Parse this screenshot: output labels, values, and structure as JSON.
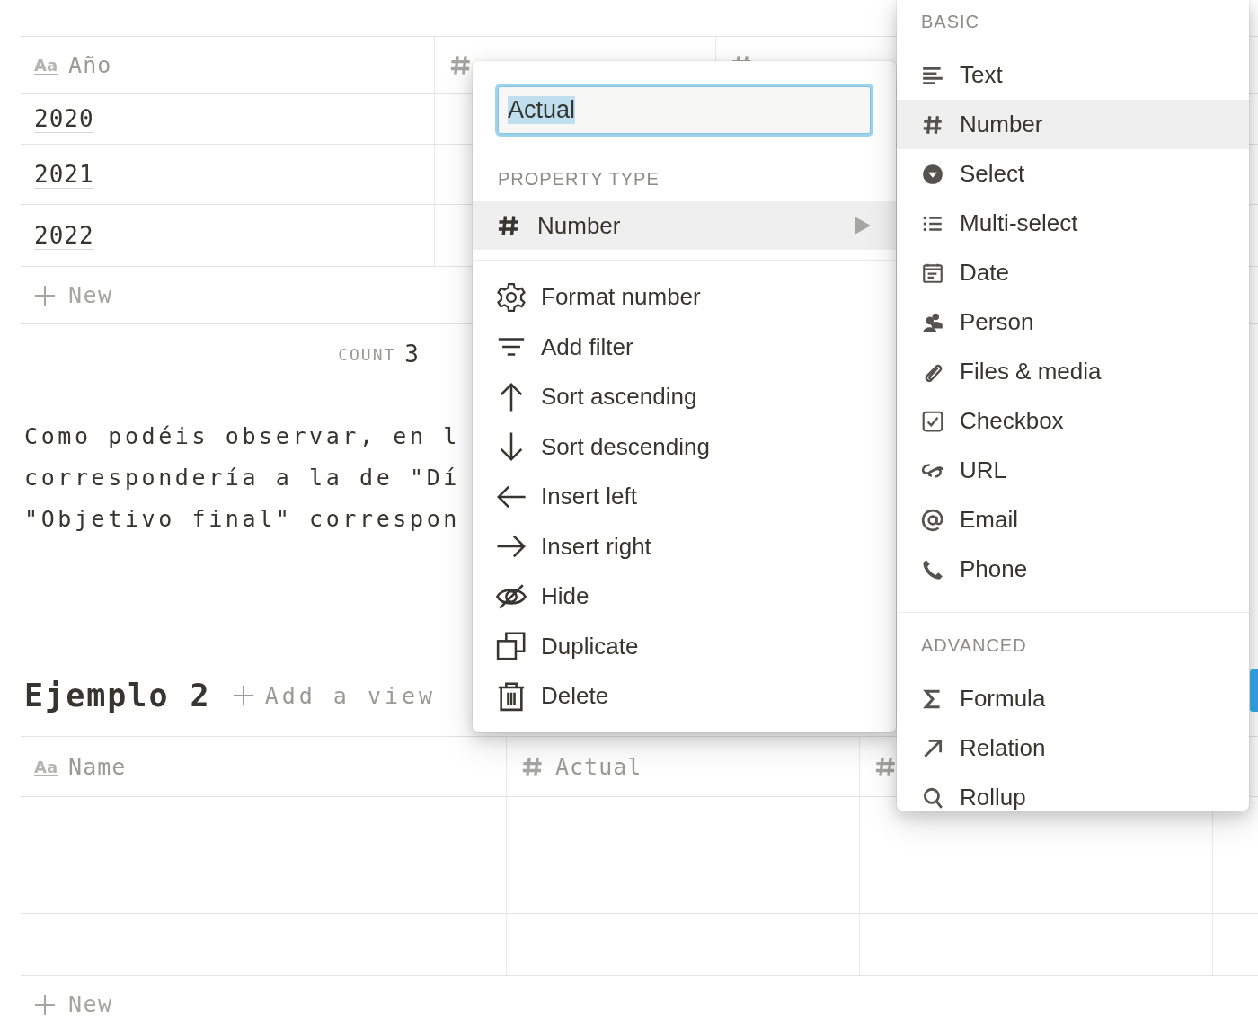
{
  "table_1": {
    "columns": [
      {
        "kind": "title",
        "icon_text": "Aa",
        "label": "Año"
      },
      {
        "kind": "number"
      },
      {
        "kind": "number"
      }
    ],
    "rows": [
      {
        "cells": [
          "2020"
        ]
      },
      {
        "cells": [
          "2021"
        ]
      },
      {
        "cells": [
          "2022"
        ]
      }
    ],
    "new_row": "New",
    "count": {
      "label": "COUNT",
      "value": "3"
    }
  },
  "paragraph_lines": [
    "Como podéis observar, en l",
    "correspondería a la de \"Dí",
    "\"Objetivo final\" correspon"
  ],
  "section_2": {
    "title": "Ejemplo 2",
    "add_view": "Add a view"
  },
  "table_2": {
    "columns": [
      {
        "kind": "title",
        "icon_text": "Aa",
        "label": "Name"
      },
      {
        "kind": "number",
        "label": "Actual"
      },
      {
        "kind": "number"
      }
    ],
    "rows": [
      {
        "kind": "empty"
      },
      {
        "kind": "empty"
      },
      {
        "kind": "empty"
      }
    ],
    "new_row": "New"
  },
  "property_menu": {
    "name_field": {
      "value": "Actual",
      "text_selected": true
    },
    "section_label": "PROPERTY TYPE",
    "type_item": {
      "kind": "number",
      "label": "Number",
      "selected": true
    },
    "items": [
      {
        "kind": "format",
        "label": "Format number"
      },
      {
        "kind": "filter",
        "label": "Add filter"
      },
      {
        "kind": "sort-asc",
        "label": "Sort ascending"
      },
      {
        "kind": "sort-desc",
        "label": "Sort descending"
      },
      {
        "kind": "insert-left",
        "label": "Insert left"
      },
      {
        "kind": "insert-right",
        "label": "Insert right"
      },
      {
        "kind": "hide",
        "label": "Hide"
      },
      {
        "kind": "duplicate",
        "label": "Duplicate"
      },
      {
        "kind": "delete",
        "label": "Delete"
      }
    ]
  },
  "type_menu": {
    "sections": [
      {
        "label": "BASIC",
        "items": [
          {
            "kind": "text",
            "label": "Text",
            "selected": false
          },
          {
            "kind": "number",
            "label": "Number",
            "selected": true
          },
          {
            "kind": "select",
            "label": "Select",
            "selected": false
          },
          {
            "kind": "multi-select",
            "label": "Multi-select",
            "selected": false
          },
          {
            "kind": "date",
            "label": "Date",
            "selected": false
          },
          {
            "kind": "person",
            "label": "Person",
            "selected": false
          },
          {
            "kind": "files",
            "label": "Files & media",
            "selected": false
          },
          {
            "kind": "checkbox",
            "label": "Checkbox",
            "selected": false
          },
          {
            "kind": "url",
            "label": "URL",
            "selected": false
          },
          {
            "kind": "email",
            "label": "Email",
            "selected": false
          },
          {
            "kind": "phone",
            "label": "Phone",
            "selected": false
          }
        ]
      },
      {
        "label": "ADVANCED",
        "items": [
          {
            "kind": "formula",
            "label": "Formula",
            "selected": false
          },
          {
            "kind": "relation",
            "label": "Relation",
            "selected": false
          },
          {
            "kind": "rollup",
            "label": "Rollup",
            "selected": false
          }
        ]
      }
    ]
  }
}
